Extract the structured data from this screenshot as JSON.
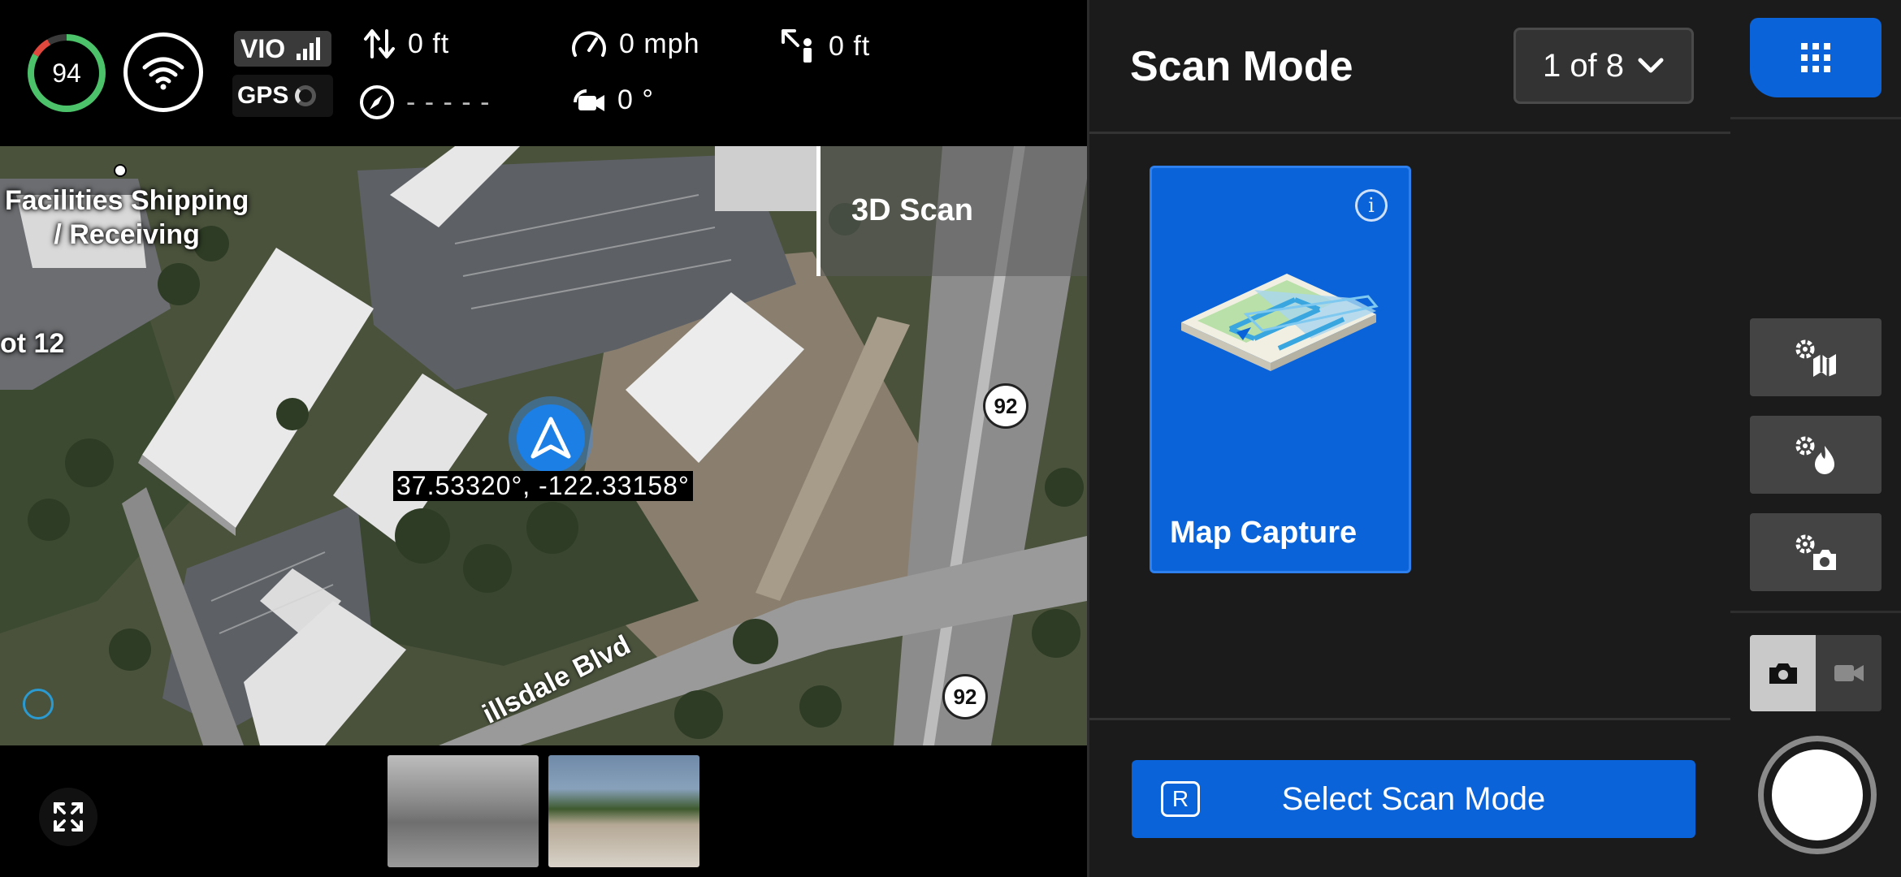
{
  "telemetry": {
    "battery_percent": "94",
    "vio_label": "VIO",
    "gps_label": "GPS",
    "altitude": "0 ft",
    "speed": "0 mph",
    "distance": "0 ft",
    "heading": "- - - - -",
    "gimbal_pitch": "0 °"
  },
  "map": {
    "poi_label": "Facilities Shipping\n/ Receiving",
    "lot_label": "ot 12",
    "overlay_label": "3D Scan",
    "road_label": "illsdale Blvd",
    "highway_shield": "92",
    "coordinates": "37.53320°, -122.33158°"
  },
  "panel": {
    "title": "Scan Mode",
    "page_indicator": "1 of 8",
    "mode_card": {
      "label": "Map Capture",
      "info_glyph": "i"
    },
    "select_key": "R",
    "select_label": "Select Scan Mode"
  },
  "colors": {
    "accent": "#0a63d8",
    "panel_bg": "#1b1b1b",
    "battery_green": "#4cc26b",
    "battery_red": "#e0483e"
  },
  "icons": {
    "grid": "grid-icon",
    "map_settings": "map-settings-icon",
    "thermal_settings": "thermal-settings-icon",
    "camera_settings": "camera-settings-icon",
    "photo": "camera-icon",
    "video": "video-icon",
    "expand": "expand-icon"
  }
}
